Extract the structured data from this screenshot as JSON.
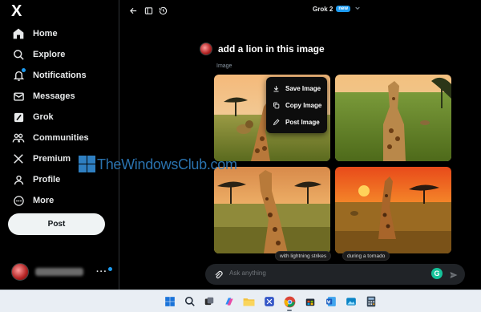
{
  "sidebar": {
    "logo": "X",
    "items": [
      {
        "label": "Home",
        "icon": "home-icon"
      },
      {
        "label": "Explore",
        "icon": "search-icon"
      },
      {
        "label": "Notifications",
        "icon": "bell-icon"
      },
      {
        "label": "Messages",
        "icon": "mail-icon"
      },
      {
        "label": "Grok",
        "icon": "grok-icon"
      },
      {
        "label": "Communities",
        "icon": "people-icon"
      },
      {
        "label": "Premium",
        "icon": "x-logo-icon"
      },
      {
        "label": "Profile",
        "icon": "person-icon"
      },
      {
        "label": "More",
        "icon": "more-circle-icon"
      }
    ],
    "post_label": "Post",
    "account_more": "···"
  },
  "topbar": {
    "model_name": "Grok 2",
    "model_badge": "new"
  },
  "conversation": {
    "prompt": "add a lion in this image",
    "image_label": "Image"
  },
  "context_menu": {
    "items": [
      {
        "label": "Save Image",
        "icon": "save-image-icon"
      },
      {
        "label": "Copy Image",
        "icon": "copy-image-icon"
      },
      {
        "label": "Post Image",
        "icon": "post-image-icon"
      }
    ]
  },
  "watermark": {
    "text": "TheWindowsClub.com"
  },
  "suggestions": [
    "with lightning strikes",
    "during a tornado"
  ],
  "input": {
    "placeholder": "Ask anything"
  },
  "taskbar": {
    "apps": [
      "windows-start-icon",
      "search-icon",
      "task-view-icon",
      "copilot-icon",
      "file-explorer-icon",
      "snipping-tool-icon",
      "chrome-icon",
      "store-icon",
      "word-icon",
      "photos-icon",
      "calculator-icon"
    ]
  },
  "colors": {
    "accent": "#1d9bf0",
    "background": "#000000",
    "post_button": "#eff3f4",
    "grammarly": "#15c39a"
  }
}
